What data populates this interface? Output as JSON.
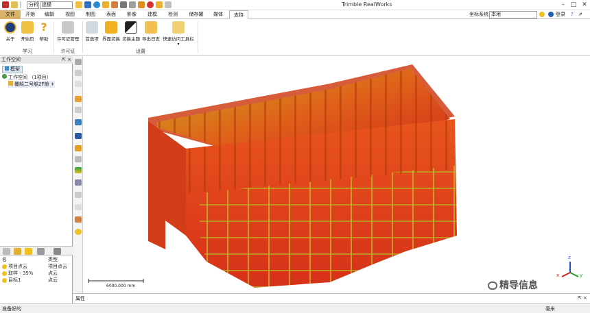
{
  "app": {
    "title": "Trimble RealWorks"
  },
  "qat": {
    "combo1": "分析",
    "combo2": "建模"
  },
  "menu": {
    "items": [
      "文件",
      "开始",
      "编辑",
      "视图",
      "制图",
      "表面",
      "影像",
      "建模",
      "检测",
      "储存罐",
      "媒体",
      "支持"
    ],
    "active": "支持",
    "coord_label": "坐标系统",
    "coord_value": "本地",
    "login": "登录"
  },
  "ribbon": {
    "buttons": {
      "about": "关于",
      "start_page": "开始页",
      "help": "帮助",
      "license": "许可证管理",
      "prefs": "首选项",
      "ui_switch": "界面切换",
      "theme": "切换主题",
      "export_log": "导出日志",
      "qat_toolbar": "快速访问工具栏"
    },
    "groups": {
      "learn": "学习",
      "license": "许可证",
      "settings": "设置"
    }
  },
  "workspace": {
    "header": "工作空间",
    "pin": "⇱ ×",
    "tab": "模型",
    "root": "工作空间 （1项目）",
    "project": "覆船二号船2F舱",
    "table": {
      "col_name": "名",
      "col_type": "类型",
      "rows": [
        {
          "name": "项目点云",
          "type": "项目点云"
        },
        {
          "name": "取样 - 35%",
          "type": "点云"
        },
        {
          "name": "目标1",
          "type": "点云"
        }
      ]
    }
  },
  "viewport": {
    "scale_label": "6000.000 mm",
    "axes": {
      "z": "z",
      "x": "x",
      "y": "y"
    },
    "watermark": "精导信息"
  },
  "properties": {
    "header": "属性"
  },
  "status": {
    "left": "准备好的",
    "unit": "毫米"
  },
  "colors": {
    "accent": "#d9b36a",
    "scan_red": "#d6301a",
    "scan_orange": "#e86a1c",
    "scan_yellow": "#c8c01a"
  }
}
